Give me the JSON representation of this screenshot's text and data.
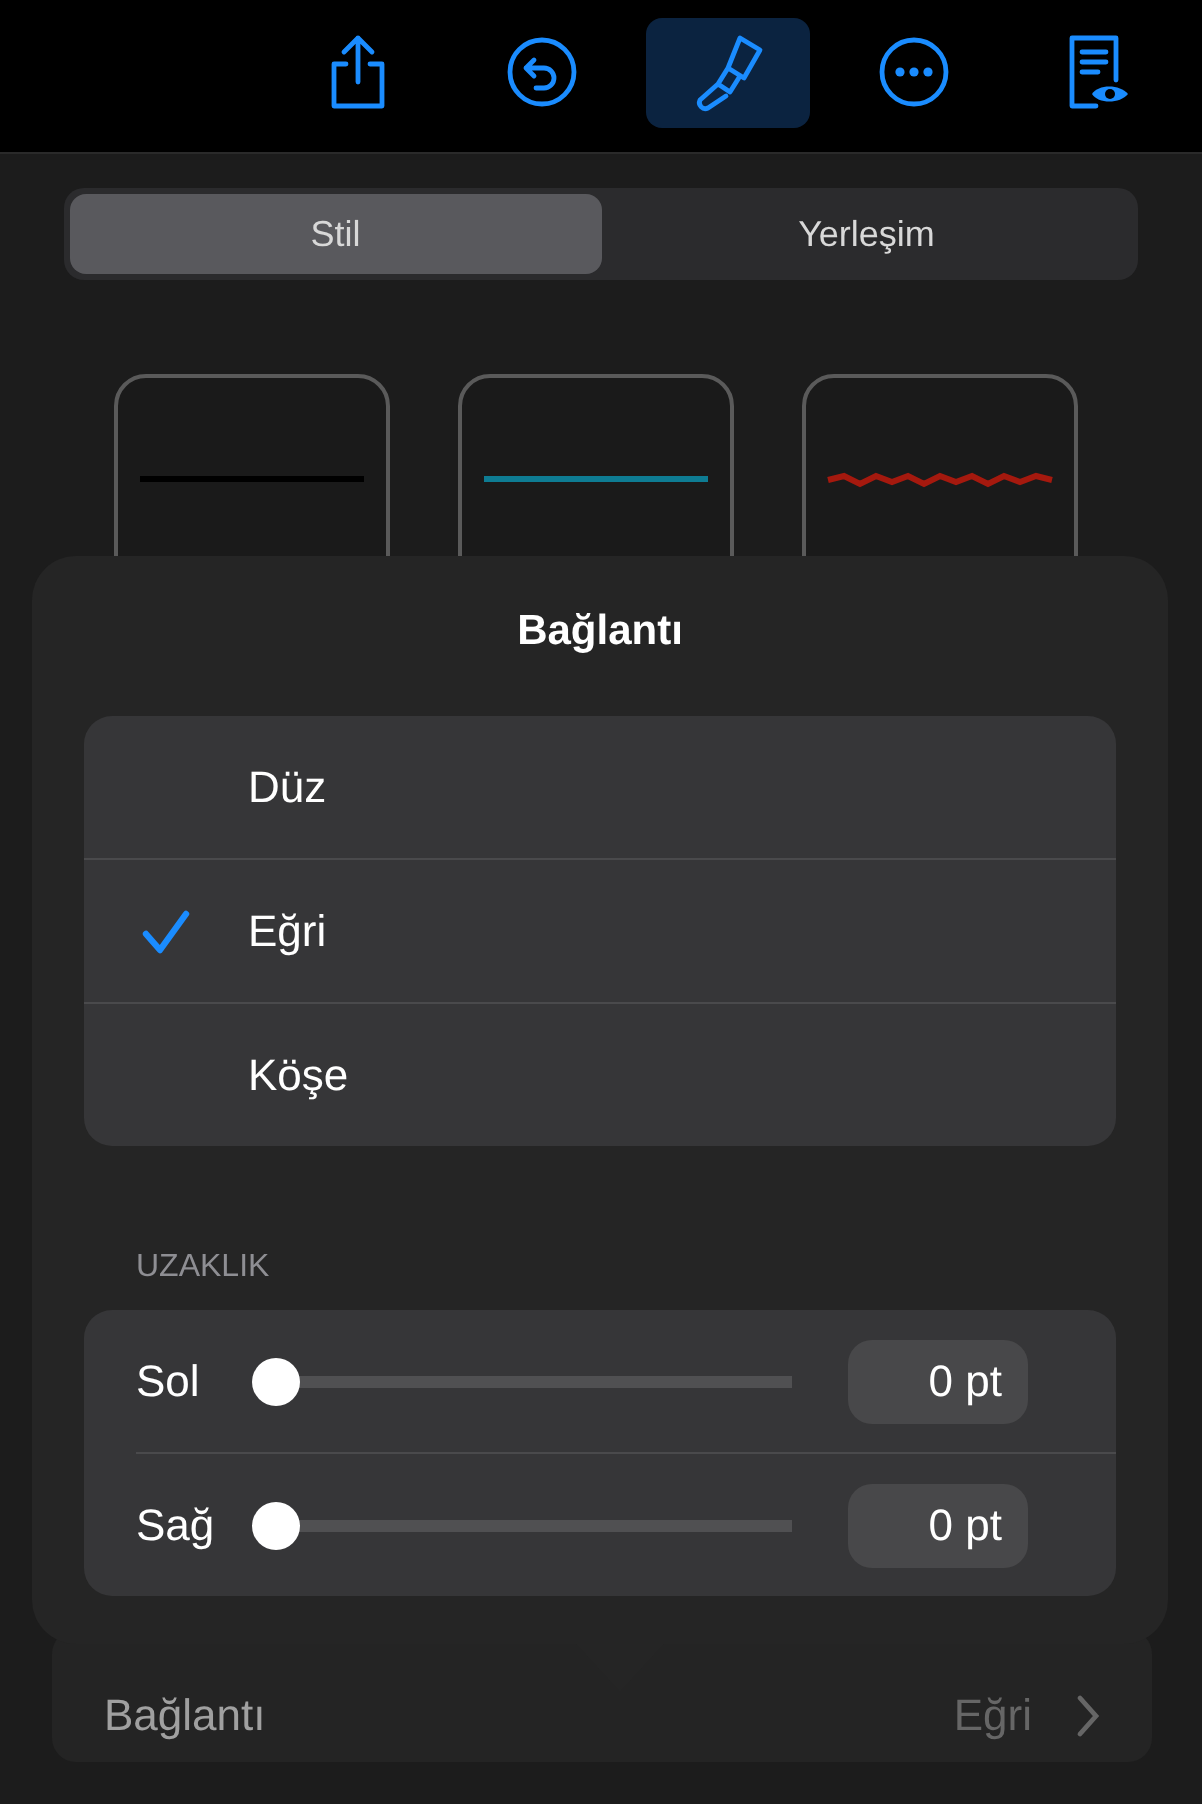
{
  "toolbar": {
    "buttons": [
      {
        "kind": "share",
        "selected": false
      },
      {
        "kind": "undo",
        "selected": false
      },
      {
        "kind": "brush",
        "selected": true
      },
      {
        "kind": "more",
        "selected": false
      },
      {
        "kind": "preview",
        "selected": false
      }
    ]
  },
  "tabs": [
    {
      "label": "Stil",
      "selected": true
    },
    {
      "label": "Yerleşim",
      "selected": false
    }
  ],
  "line_styles": [
    {
      "kind": "solid",
      "color": "#000000"
    },
    {
      "kind": "solid",
      "color": "#0e7c93"
    },
    {
      "kind": "rough",
      "color": "#a5190e"
    }
  ],
  "popover": {
    "title": "Bağlantı",
    "options": [
      {
        "label": "Düz",
        "selected": false
      },
      {
        "label": "Eğri",
        "selected": true
      },
      {
        "label": "Köşe",
        "selected": false
      }
    ],
    "section_label": "UZAKLIK",
    "sliders": [
      {
        "label": "Sol",
        "level": 0,
        "value": "0 pt"
      },
      {
        "label": "Sağ",
        "level": 0,
        "value": "0 pt"
      }
    ]
  },
  "connection_row": {
    "label": "Bağlantı",
    "value": "Eğri"
  }
}
